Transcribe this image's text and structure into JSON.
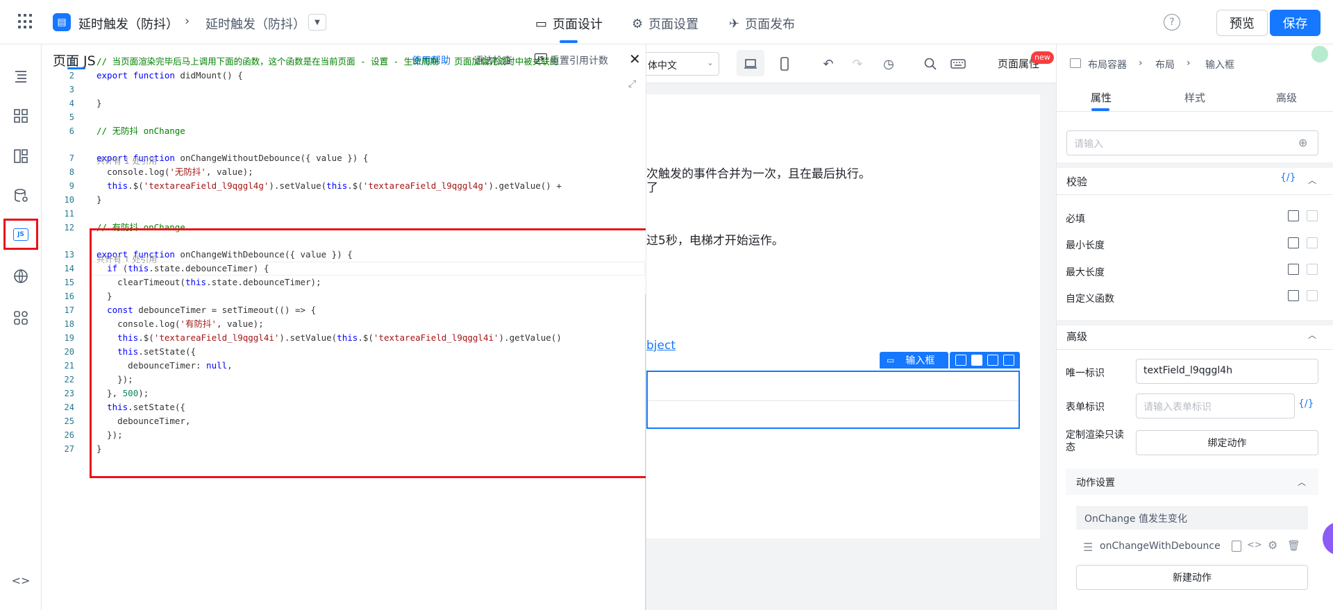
{
  "topbar": {
    "app_title": "延时触发（防抖）",
    "breadcrumb_current": "延时触发（防抖）",
    "tabs": [
      {
        "label": "页面设计",
        "active": true
      },
      {
        "label": "页面设置",
        "active": false
      },
      {
        "label": "页面发布",
        "active": false
      }
    ],
    "preview_label": "预览",
    "save_label": "保存",
    "accent_color": "#1677ff"
  },
  "js_panel": {
    "title": "页面 JS",
    "help_link": "使用帮助",
    "syntax_check": "语法检查",
    "reset_ref_count": "重置引用计数",
    "ref_note": "共计有 1 处引用",
    "lines": [
      {
        "n": "1",
        "text": "// 当页面渲染完毕后马上调用下面的函数，这个函数是在当前页面 - 设置 - 生命周期 - 页面加载完成时中被关联的"
      },
      {
        "n": "2",
        "text": "export function didMount() {"
      },
      {
        "n": "3",
        "text": ""
      },
      {
        "n": "4",
        "text": "}"
      },
      {
        "n": "5",
        "text": ""
      },
      {
        "n": "6",
        "text": "// 无防抖 onChange"
      },
      {
        "n": "7",
        "text": "export function onChangeWithoutDebounce({ value }) {"
      },
      {
        "n": "8",
        "text": "  console.log('无防抖', value);"
      },
      {
        "n": "9",
        "text": "  this.$('textareaField_l9qggl4g').setValue(this.$('textareaField_l9qggl4g').getValue() +"
      },
      {
        "n": "10",
        "text": "}"
      },
      {
        "n": "11",
        "text": ""
      },
      {
        "n": "12",
        "text": "// 有防抖 onChange"
      },
      {
        "n": "13",
        "text": "export function onChangeWithDebounce({ value }) {"
      },
      {
        "n": "14",
        "text": "  if (this.state.debounceTimer) {"
      },
      {
        "n": "15",
        "text": "    clearTimeout(this.state.debounceTimer);"
      },
      {
        "n": "16",
        "text": "  }"
      },
      {
        "n": "17",
        "text": "  const debounceTimer = setTimeout(() => {"
      },
      {
        "n": "18",
        "text": "    console.log('有防抖', value);"
      },
      {
        "n": "19",
        "text": "    this.$('textareaField_l9qggl4i').setValue(this.$('textareaField_l9qggl4i').getValue()"
      },
      {
        "n": "20",
        "text": "    this.setState({"
      },
      {
        "n": "21",
        "text": "      debounceTimer: null,"
      },
      {
        "n": "22",
        "text": "    });"
      },
      {
        "n": "23",
        "text": "  }, 500);"
      },
      {
        "n": "24",
        "text": "  this.setState({"
      },
      {
        "n": "25",
        "text": "    debounceTimer,"
      },
      {
        "n": "26",
        "text": "  });"
      },
      {
        "n": "27",
        "text": "}"
      }
    ]
  },
  "canvas": {
    "lang_select": "体中文",
    "page_properties": "页面属性",
    "new_badge": "new",
    "text_line1": "次触发的事件合并为一次，且在最后执行。",
    "text_line2": "了",
    "text_line3": "过5秒，电梯才开始运作。",
    "link_text": "bject",
    "selected_tag": "输入框"
  },
  "right_panel": {
    "breadcrumb": [
      "布局容器",
      "布局",
      "输入框"
    ],
    "tabs": [
      {
        "label": "属性",
        "active": true
      },
      {
        "label": "样式",
        "active": false
      },
      {
        "label": "高级",
        "active": false
      }
    ],
    "top_input_placeholder": "请输入",
    "validation_title": "校验",
    "fx_label": "{/}",
    "validation_items": [
      "必填",
      "最小长度",
      "最大长度",
      "自定义函数"
    ],
    "advanced_title": "高级",
    "unique_id_label": "唯一标识",
    "unique_id_value": "textField_l9qggl4h",
    "form_id_label": "表单标识",
    "form_id_placeholder": "请输入表单标识",
    "custom_render_label": "定制渲染只读态",
    "bind_action_label": "绑定动作",
    "action_settings_title": "动作设置",
    "event_name": "OnChange 值发生变化",
    "handler_name": "onChangeWithDebounce",
    "new_action_label": "新建动作"
  }
}
